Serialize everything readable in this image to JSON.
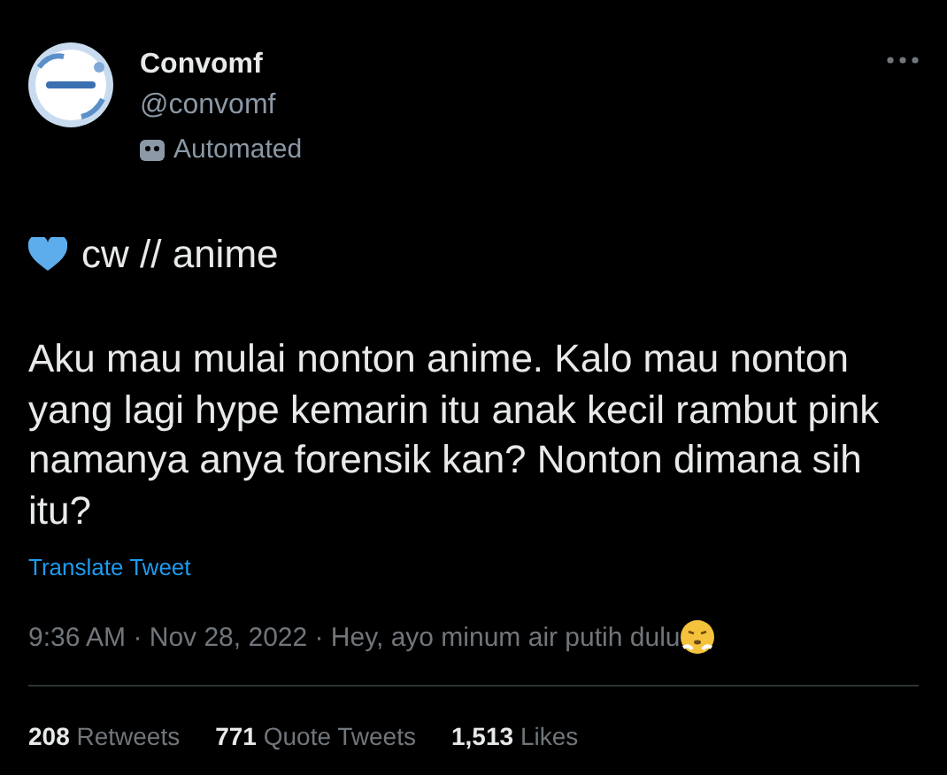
{
  "author": {
    "name": "Convomf",
    "handle": "@convomf",
    "label": "Automated"
  },
  "tweet": {
    "topic": "cw // anime",
    "text": "Aku mau mulai nonton anime. Kalo mau nonton yang lagi hype kemarin itu anak kecil rambut pink namanya anya forensik kan? Nonton dimana sih itu?",
    "translate": "Translate Tweet",
    "meta": "9:36 AM · Nov 28, 2022 · Hey, ayo minum air putih dulu"
  },
  "stats": [
    {
      "count": "208",
      "label": "Retweets"
    },
    {
      "count": "771",
      "label": "Quote Tweets"
    },
    {
      "count": "1,513",
      "label": "Likes"
    }
  ]
}
